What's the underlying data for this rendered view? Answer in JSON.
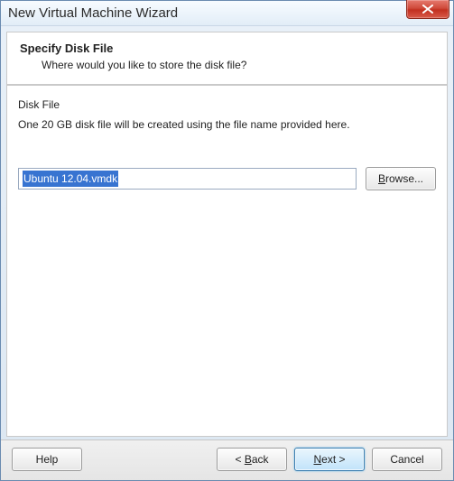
{
  "window": {
    "title": "New Virtual Machine Wizard"
  },
  "header": {
    "title": "Specify Disk File",
    "subtitle": "Where would you like to store the disk file?"
  },
  "body": {
    "section_label": "Disk File",
    "description": "One 20 GB disk file will be created using the file name provided here.",
    "filename": "Ubuntu 12.04.vmdk",
    "browse_label": "Browse..."
  },
  "footer": {
    "help_label": "Help",
    "back_label": "< Back",
    "next_label": "Next >",
    "cancel_label": "Cancel"
  }
}
